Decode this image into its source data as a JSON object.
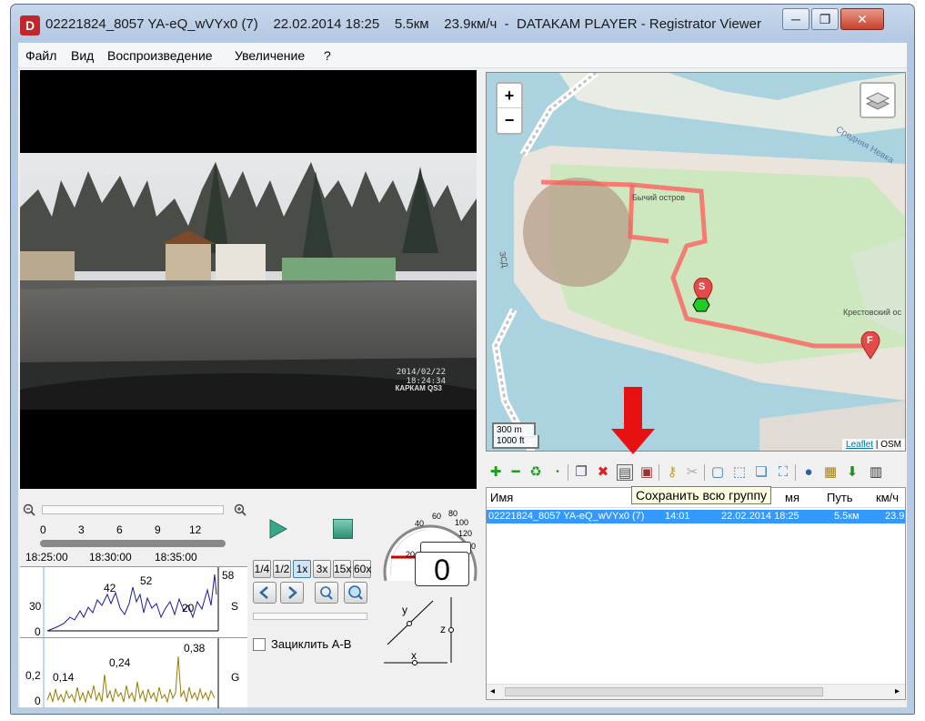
{
  "window": {
    "title": "02221824_8057 YA-eQ_wVYx0 (7)    22.02.2014 18:25    5.5км    23.9км/ч  -  DATAKAM PLAYER - Registrator Viewer",
    "icon_letter": "D",
    "min_label": "─",
    "max_label": "❐",
    "close_label": "✕"
  },
  "menu": {
    "items": [
      "Файл",
      "Вид",
      "Воспроизведение",
      "Увеличение",
      "?"
    ]
  },
  "video": {
    "timestamp_date": "2014/02/22",
    "timestamp_time": "18:24:34",
    "brand": "КАРКАМ QS3"
  },
  "timeline": {
    "ticks": [
      "0",
      "3",
      "6",
      "9",
      "12"
    ],
    "times": [
      "18:25:00",
      "18:30:00",
      "18:35:00"
    ]
  },
  "speed_graph": {
    "label": "S",
    "y_ticks": [
      "30",
      "0"
    ],
    "annotations": [
      "42",
      "52",
      "20",
      "58"
    ]
  },
  "g_graph": {
    "label": "G",
    "y_ticks": [
      "0,2",
      "0"
    ],
    "annotations": [
      "0,14",
      "0,24",
      "0,38"
    ]
  },
  "controls": {
    "speeds": [
      "1/4",
      "1/2",
      "1x",
      "3x",
      "15x",
      "60x"
    ],
    "active_speed": "1x",
    "loop_label": "Зациклить A-B",
    "speedometer_value": "0",
    "speedometer_ticks": [
      "20",
      "40",
      "60",
      "80",
      "100",
      "120",
      "140"
    ],
    "axis_x": "x",
    "axis_y": "y",
    "axis_z": "z"
  },
  "map": {
    "zoom_in": "+",
    "zoom_out": "−",
    "scale_m": "300 m",
    "scale_ft": "1000 ft",
    "attribution_link": "Leaflet",
    "attribution_osm": "OSM",
    "label_island": "Бычий остров",
    "label_river": "Средняя Невка",
    "label_krest": "Крестовский ос",
    "label_road": "ЗСД",
    "marker_start": "S",
    "marker_finish": "F"
  },
  "table": {
    "headers": [
      "Имя",
      "Путь",
      "км/ч"
    ],
    "header_partial": "мя",
    "rows": [
      {
        "name": "02221824_8057 YA-eQ_wVYx0 (7)",
        "time": "14:01",
        "date": "22.02.2014 18:25",
        "path": "5.5км",
        "speed": "23.9"
      }
    ]
  },
  "tooltip": "Сохранить всю группу",
  "colors": {
    "route": "#ff5a5a",
    "selection": "#3399ff",
    "speed_line": "#1a1a9a",
    "g_line": "#9a7a00"
  }
}
